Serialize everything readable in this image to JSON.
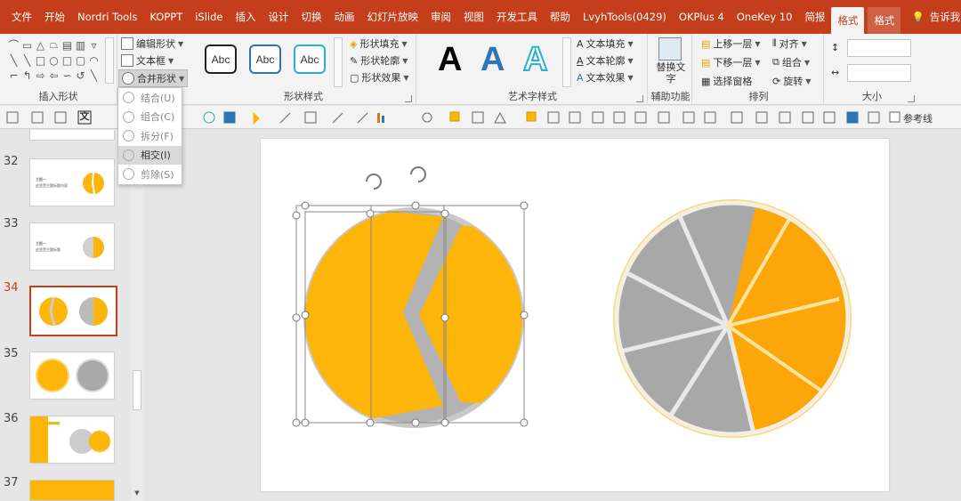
{
  "tabs": [
    "文件",
    "开始",
    "Nordri Tools",
    "KOPPT",
    "iSlide",
    "插入",
    "设计",
    "切换",
    "动画",
    "幻灯片放映",
    "审阅",
    "视图",
    "开发工具",
    "帮助",
    "LvyhTools(0429)",
    "OKPlus 4",
    "OneKey 10",
    "简报",
    "格式",
    "格式"
  ],
  "active_tab_index": 18,
  "tell_me": "告诉我",
  "ribbon": {
    "insert_shapes": {
      "label": "插入形状",
      "edit_shape": "编辑形状",
      "text_box": "文本框",
      "merge_shapes": "合并形状"
    },
    "shape_styles": {
      "label": "形状样式",
      "sample": "Abc",
      "fill": "形状填充",
      "outline": "形状轮廓",
      "effects": "形状效果"
    },
    "wordart": {
      "label": "艺术字样式",
      "letter": "A",
      "text_fill": "文本填充",
      "text_outline": "文本轮廓",
      "text_effects": "文本效果"
    },
    "accessibility": {
      "label": "辅助功能",
      "alt_text": "替换文字"
    },
    "arrange": {
      "label": "排列",
      "bring_forward": "上移一层",
      "send_backward": "下移一层",
      "selection_pane": "选择窗格",
      "align": "对齐",
      "group": "组合",
      "rotate": "旋转"
    },
    "size": {
      "label": "大小"
    }
  },
  "toolbar": {
    "guide_label": "参考线",
    "text_button": "文"
  },
  "merge_menu": [
    {
      "label": "结合(U)",
      "active": false
    },
    {
      "label": "组合(C)",
      "active": false
    },
    {
      "label": "拆分(F)",
      "active": false
    },
    {
      "label": "相交(I)",
      "active": true
    },
    {
      "label": "剪除(S)",
      "active": false
    }
  ],
  "slides": [
    {
      "num": "32",
      "title": "主题一",
      "subtitle": "这里是主题标题内容"
    },
    {
      "num": "33",
      "title": "主题一",
      "subtitle": "这里是主题标题"
    },
    {
      "num": "34",
      "active": true
    },
    {
      "num": "35"
    },
    {
      "num": "36"
    },
    {
      "num": "37"
    }
  ],
  "colors": {
    "accent": "#c43e1c",
    "orange": "#fdb50a",
    "canvas": "#ffffff"
  }
}
